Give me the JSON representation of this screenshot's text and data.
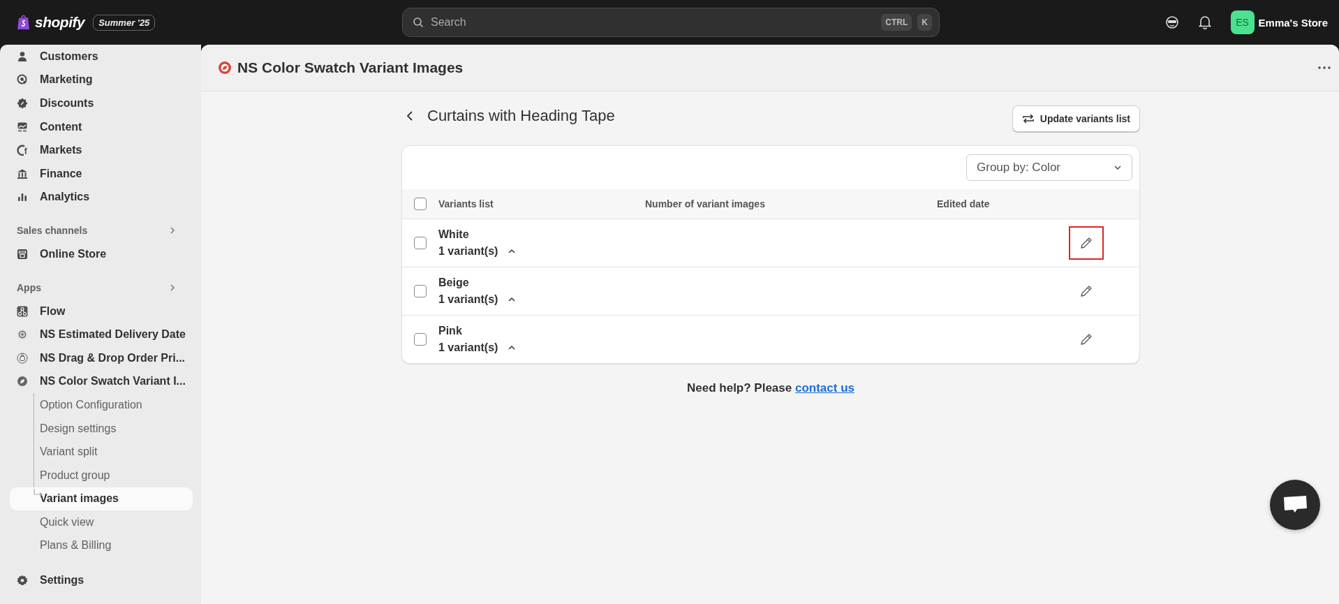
{
  "topbar": {
    "logo_text": "shopify",
    "edition_badge": "Summer '25",
    "search": {
      "placeholder": "Search",
      "shortcut_keys": [
        "CTRL",
        "K"
      ]
    },
    "store": {
      "avatar_initials": "ES",
      "name": "Emma's Store"
    }
  },
  "sidebar": {
    "items": [
      {
        "label": "Customers",
        "selected": false
      },
      {
        "label": "Marketing",
        "selected": false
      },
      {
        "label": "Discounts",
        "selected": false
      },
      {
        "label": "Content",
        "selected": false
      },
      {
        "label": "Markets",
        "selected": false
      },
      {
        "label": "Finance",
        "selected": false
      },
      {
        "label": "Analytics",
        "selected": false
      }
    ],
    "sections": [
      {
        "title": "Sales channels",
        "items": [
          {
            "label": "Online Store",
            "selected": false
          }
        ]
      },
      {
        "title": "Apps",
        "items": [
          {
            "label": "Flow",
            "selected": false
          },
          {
            "label": "NS Estimated Delivery Date",
            "selected": false
          },
          {
            "label": "NS Drag & Drop Order Pri...",
            "selected": false
          },
          {
            "label": "NS Color Swatch Variant I...",
            "selected": false,
            "children": [
              {
                "label": "Option Configuration",
                "selected": false
              },
              {
                "label": "Design settings",
                "selected": false
              },
              {
                "label": "Variant split",
                "selected": false
              },
              {
                "label": "Product group",
                "selected": false
              },
              {
                "label": "Variant images",
                "selected": true
              },
              {
                "label": "Quick view",
                "selected": false
              },
              {
                "label": "Plans & Billing",
                "selected": false
              }
            ]
          }
        ]
      }
    ],
    "settings": {
      "label": "Settings"
    }
  },
  "app_header": {
    "title": "NS Color Swatch Variant Images"
  },
  "page": {
    "title": "Curtains with Heading Tape",
    "update_button": "Update variants list",
    "group_by": {
      "value": "Group by: Color"
    },
    "table": {
      "select_all_checked": false,
      "columns": [
        "Variants list",
        "Number of variant images",
        "Edited date"
      ],
      "rows": [
        {
          "name": "White",
          "count": "1 variant(s)",
          "checked": false,
          "expanded": true,
          "edit_highlighted": true
        },
        {
          "name": "Beige",
          "count": "1 variant(s)",
          "checked": false,
          "expanded": true,
          "edit_highlighted": false
        },
        {
          "name": "Pink",
          "count": "1 variant(s)",
          "checked": false,
          "expanded": true,
          "edit_highlighted": false
        }
      ]
    },
    "help": {
      "text": "Need help? Please",
      "link": "contact us"
    }
  }
}
